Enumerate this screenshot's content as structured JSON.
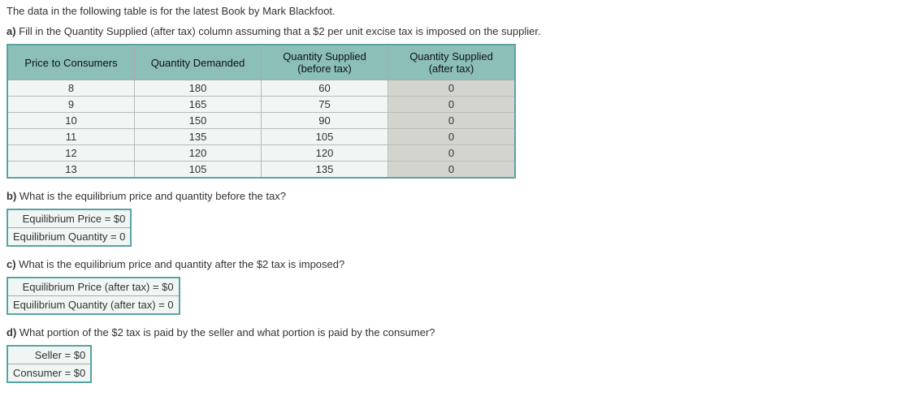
{
  "intro": "The data in the following table is for the latest Book by Mark Blackfoot.",
  "a": {
    "label": "a)",
    "text": " Fill in the Quantity Supplied (after tax) column assuming that a $2 per unit excise tax is imposed on the supplier."
  },
  "table": {
    "headers": [
      "Price to Consumers",
      "Quantity Demanded",
      "Quantity Supplied (before tax)",
      "Quantity Supplied (after tax)"
    ],
    "rows": [
      {
        "price": "8",
        "qd": "180",
        "qs_before": "60",
        "qs_after": "0"
      },
      {
        "price": "9",
        "qd": "165",
        "qs_before": "75",
        "qs_after": "0"
      },
      {
        "price": "10",
        "qd": "150",
        "qs_before": "90",
        "qs_after": "0"
      },
      {
        "price": "11",
        "qd": "135",
        "qs_before": "105",
        "qs_after": "0"
      },
      {
        "price": "12",
        "qd": "120",
        "qs_before": "120",
        "qs_after": "0"
      },
      {
        "price": "13",
        "qd": "105",
        "qs_before": "135",
        "qs_after": "0"
      }
    ]
  },
  "b": {
    "label": "b)",
    "text": " What is the equilibrium price and quantity before the tax?",
    "rows": [
      {
        "label": "Equilibrium Price = $",
        "value": "0"
      },
      {
        "label": "Equilibrium Quantity = ",
        "value": "0"
      }
    ]
  },
  "c": {
    "label": "c)",
    "text": " What is the equilibrium price and quantity after the $2 tax is imposed?",
    "rows": [
      {
        "label": "Equilibrium Price (after tax) = $",
        "value": "0"
      },
      {
        "label": "Equilibrium Quantity (after tax) = ",
        "value": "0"
      }
    ]
  },
  "d": {
    "label": "d)",
    "text": " What portion of the $2 tax is paid by the seller and what portion is paid by the consumer?",
    "rows": [
      {
        "label": "Seller = $",
        "value": "0"
      },
      {
        "label": "Consumer = $",
        "value": "0"
      }
    ]
  }
}
